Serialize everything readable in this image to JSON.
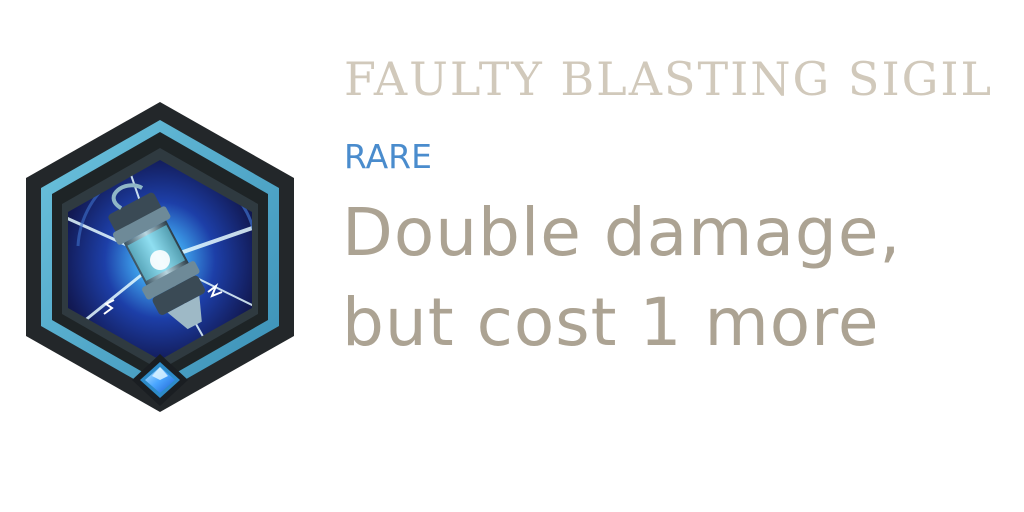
{
  "item": {
    "name": "FAULTY BLASTING SIGIL",
    "rarity": "RARE",
    "description_lines": [
      "Double damage,",
      "but cost 1 more"
    ],
    "icon": "sigil-icon",
    "rarity_gem_icon": "diamond-gem-icon"
  },
  "colors": {
    "title": "#d1c9bb",
    "rarity": "#4a8ccd",
    "description": "#aca393",
    "hex_frame": "#23272a",
    "hex_ring": "#4fa3c4"
  }
}
